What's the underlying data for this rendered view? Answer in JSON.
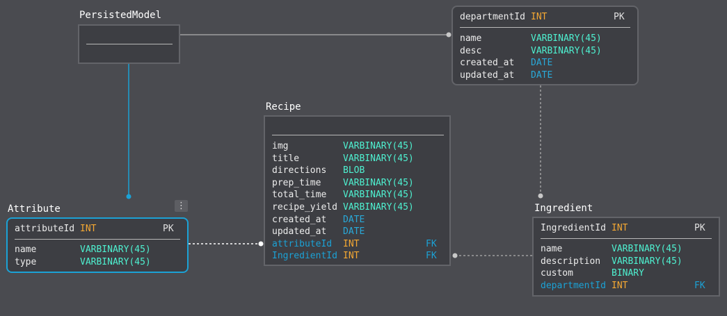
{
  "colors": {
    "background": "#4a4b50",
    "table_bg": "#3d3e43",
    "table_border": "#636469",
    "selected_border": "#1ba2d6",
    "type_varbinary": "#4ef0d0",
    "type_int": "#f5a833",
    "type_date": "#29a9d9",
    "foreign_key": "#1ba2d6"
  },
  "menu_icon": "⋮",
  "tables": {
    "persisted": {
      "title": "PersistedModel"
    },
    "department": {
      "pk": {
        "name": "departmentId",
        "type": "INT",
        "key": "PK"
      },
      "columns": [
        {
          "name": "name",
          "type": "VARBINARY(45)"
        },
        {
          "name": "desc",
          "type": "VARBINARY(45)"
        },
        {
          "name": "created_at",
          "type": "DATE"
        },
        {
          "name": "updated_at",
          "type": "DATE"
        }
      ]
    },
    "recipe": {
      "title": "Recipe",
      "columns": [
        {
          "name": "img",
          "type": "VARBINARY(45)"
        },
        {
          "name": "title",
          "type": "VARBINARY(45)"
        },
        {
          "name": "directions",
          "type": "BLOB"
        },
        {
          "name": "prep_time",
          "type": "VARBINARY(45)"
        },
        {
          "name": "total_time",
          "type": "VARBINARY(45)"
        },
        {
          "name": "recipe_yield",
          "type": "VARBINARY(45)"
        },
        {
          "name": "created_at",
          "type": "DATE"
        },
        {
          "name": "updated_at",
          "type": "DATE"
        },
        {
          "name": "attributeId",
          "type": "INT",
          "key": "FK"
        },
        {
          "name": "IngredientId",
          "type": "INT",
          "key": "FK"
        }
      ]
    },
    "attribute": {
      "title": "Attribute",
      "pk": {
        "name": "attributeId",
        "type": "INT",
        "key": "PK"
      },
      "columns": [
        {
          "name": "name",
          "type": "VARBINARY(45)"
        },
        {
          "name": "type",
          "type": "VARBINARY(45)"
        }
      ]
    },
    "ingredient": {
      "title": "Ingredient",
      "pk": {
        "name": "IngredientId",
        "type": "INT",
        "key": "PK"
      },
      "columns": [
        {
          "name": "name",
          "type": "VARBINARY(45)"
        },
        {
          "name": "description",
          "type": "VARBINARY(45)"
        },
        {
          "name": "custom",
          "type": "BINARY"
        },
        {
          "name": "departmentId",
          "type": "INT",
          "key": "FK"
        }
      ]
    }
  }
}
